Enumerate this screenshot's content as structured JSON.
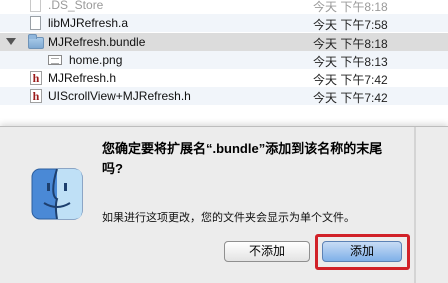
{
  "files": [
    {
      "name": ".DS_Store",
      "date": "今天 下午8:18",
      "faded": true
    },
    {
      "name": "libMJRefresh.a",
      "date": "今天 下午7:58"
    },
    {
      "name": "MJRefresh.bundle",
      "date": "今天 下午8:18",
      "selected": true
    },
    {
      "name": "home.png",
      "date": "今天 下午8:13"
    },
    {
      "name": "MJRefresh.h",
      "date": "今天 下午7:42"
    },
    {
      "name": "UIScrollView+MJRefresh.h",
      "date": "今天 下午7:42"
    }
  ],
  "dialog": {
    "title": "您确定要将扩展名“.bundle”添加到该名称的末尾吗?",
    "message": "如果进行这项更改，您的文件夹会显示为单个文件。",
    "cancel_label": "不添加",
    "add_label": "添加",
    "highlight_color": "#d12128"
  }
}
